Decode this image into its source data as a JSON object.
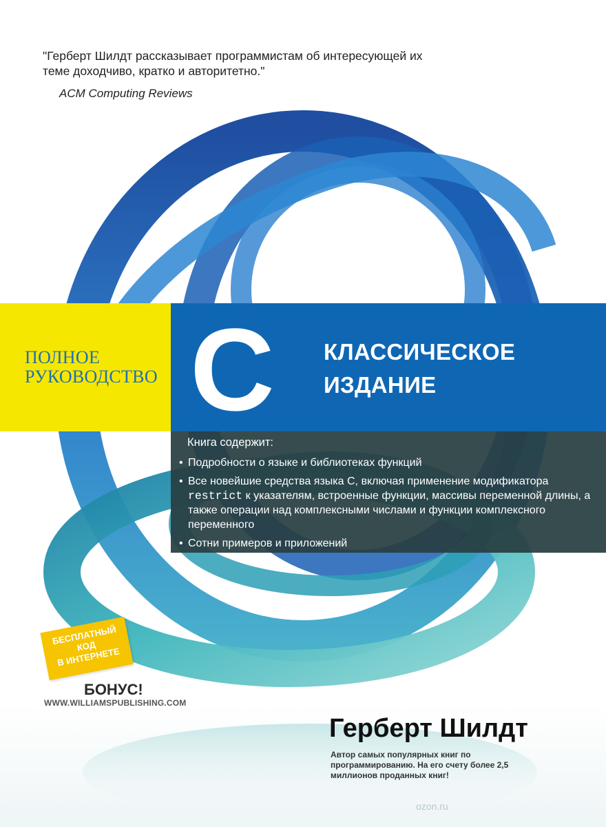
{
  "quote": {
    "text": "\"Герберт Шилдт рассказывает программистам об интересующей их теме доходчиво, кратко и авторитетно.\"",
    "source": "ACM Computing Reviews"
  },
  "band": {
    "guide_line1": "ПОЛНОЕ",
    "guide_line2": "РУКОВОДСТВО",
    "letter": "C",
    "edition_line1": "КЛАССИЧЕСКОЕ",
    "edition_line2": "ИЗДАНИЕ"
  },
  "contents": {
    "title": "Книга содержит:",
    "bullet": "•",
    "items": {
      "item1": "Подробности о языке и библиотеках функций",
      "item2_pre": "Все новейшие средства языка С, включая применение модификатора ",
      "item2_code": "restrict",
      "item2_post": " к указателям, встроенные функции, массивы переменной длины, а также операции над комплексными числами и функции комплексного переменного",
      "item3": "Сотни примеров и приложений"
    }
  },
  "badge": {
    "line1": "БЕСПЛАТНЫЙ",
    "line2": "КОД",
    "line3": "В ИНТЕРНЕТЕ"
  },
  "bonus": "БОНУС!",
  "site": "WWW.WILLIAMSPUBLISHING.COM",
  "author": {
    "name": "Герберт Шилдт",
    "description": "Автор самых популярных книг по программированию. На его счету более 2,5 миллионов проданных книг!"
  },
  "watermark": "ozon.ru",
  "colors": {
    "blue_band": "#0f67b4",
    "yellow_band": "#f6e700",
    "dark_panel": "#283e42",
    "badge": "#f6c400",
    "ribbon_blue": "#1f64b8",
    "ribbon_teal": "#2aa5ad"
  }
}
